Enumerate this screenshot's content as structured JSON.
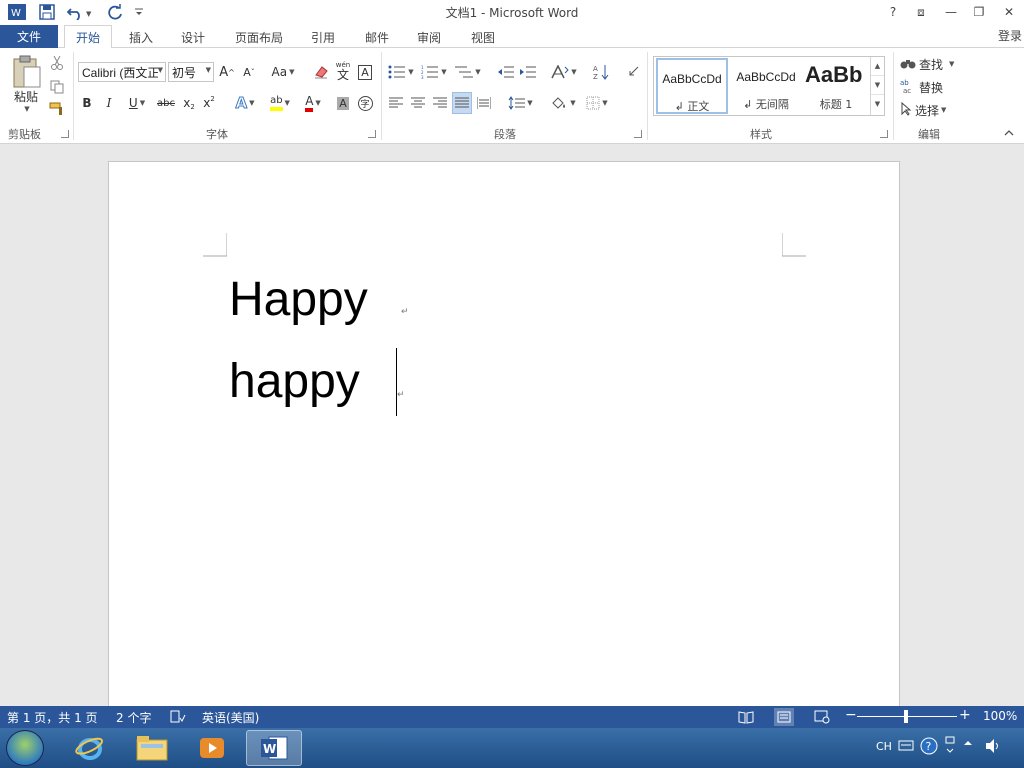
{
  "titlebar": {
    "title": "文档1 - Microsoft Word",
    "help": "?",
    "ribbon_display": "⧈",
    "minimize": "—",
    "restore": "❐",
    "close": "✕"
  },
  "tabs": {
    "file": "文件",
    "items": [
      "开始",
      "插入",
      "设计",
      "页面布局",
      "引用",
      "邮件",
      "审阅",
      "视图"
    ],
    "active": "开始",
    "login": "登录"
  },
  "ribbon": {
    "clipboard": {
      "paste": "粘贴",
      "label": "剪贴板"
    },
    "font": {
      "font_name": "Calibri (西文正",
      "font_size": "初号",
      "grow": "A",
      "shrink": "A",
      "case": "Aa",
      "pinyin_top": "wén",
      "pinyin_char": "文",
      "border_char": "A",
      "bold": "B",
      "italic": "I",
      "underline": "U",
      "strike": "abc",
      "subscript": "x",
      "superscript": "x",
      "sub_mark": "2",
      "sup_mark": "2",
      "text_effect": "A",
      "highlight": "ab",
      "font_color": "A",
      "char_shading": "A",
      "enclose": "字",
      "label": "字体"
    },
    "paragraph": {
      "label": "段落"
    },
    "styles": {
      "items": [
        {
          "sample": "AaBbCcDd",
          "name": "↲ 正文"
        },
        {
          "sample": "AaBbCcDd",
          "name": "↲ 无间隔"
        },
        {
          "sample": "AaBb",
          "name": "标题 1"
        }
      ],
      "label": "样式"
    },
    "editing": {
      "find": "查找",
      "replace": "替换",
      "select": "选择",
      "label": "编辑"
    }
  },
  "document": {
    "lines": [
      "Happy",
      "happy"
    ],
    "para_mark": "↵"
  },
  "statusbar": {
    "page": "第 1 页，共 1 页",
    "words": "2 个字",
    "language": "英语(美国)",
    "zoom": "100%"
  },
  "taskbar": {
    "lang": "CH"
  }
}
